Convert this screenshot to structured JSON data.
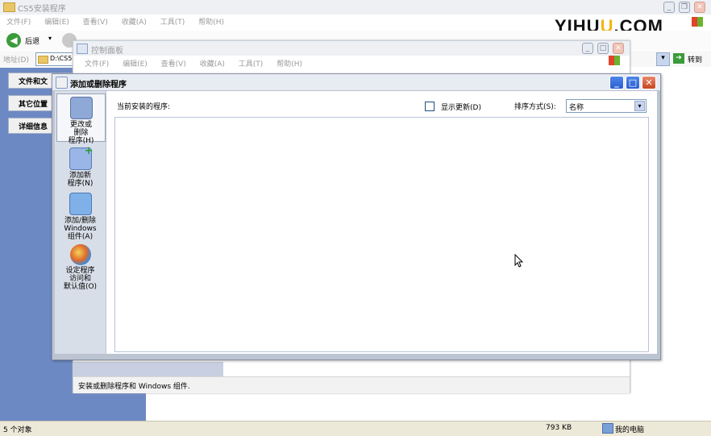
{
  "watermark": {
    "text_a": "YIHU",
    "text_b": "U",
    "text_c": ".COM"
  },
  "explorer": {
    "title": "CS5安装程序",
    "menu": [
      "文件(F)",
      "编辑(E)",
      "查看(V)",
      "收藏(A)",
      "工具(T)",
      "帮助(H)"
    ],
    "back_label": "后退",
    "address_label": "地址(D)",
    "address_value": "D:\\CS5",
    "go_label": "转到",
    "side_buttons": [
      "文件和文",
      "其它位置",
      "详细信息"
    ],
    "status_left": "5 个对象",
    "status_size": "793 KB",
    "status_location": "我的电脑"
  },
  "control_panel": {
    "title": "控制面板",
    "menu": [
      "文件(F)",
      "编辑(E)",
      "查看(V)",
      "收藏(A)",
      "工具(T)",
      "帮助(H)"
    ],
    "status_text": "安装或删除程序和 Windows 组件."
  },
  "dialog": {
    "title": "添加或删除程序",
    "nav": [
      {
        "label": "更改或\n删除\n程序(H)",
        "icon": "change-remove-programs-icon",
        "active": true
      },
      {
        "label": "添加新\n程序(N)",
        "icon": "add-new-programs-icon",
        "active": false
      },
      {
        "label": "添加/删除\nWindows\n组件(A)",
        "icon": "windows-components-icon",
        "active": false
      },
      {
        "label": "设定程序\n访问和\n默认值(O)",
        "icon": "program-defaults-icon",
        "active": false
      }
    ],
    "current_programs_label": "当前安装的程序:",
    "show_updates_label": "显示更新(D)",
    "sort_label": "排序方式(S):",
    "sort_value": "名称"
  },
  "colors": {
    "xp_blue": "#0a53d6",
    "sidebar_blue": "#6d89c4",
    "dialog_frame": "#bcc4d2",
    "watermark_accent": "#f2b418"
  }
}
